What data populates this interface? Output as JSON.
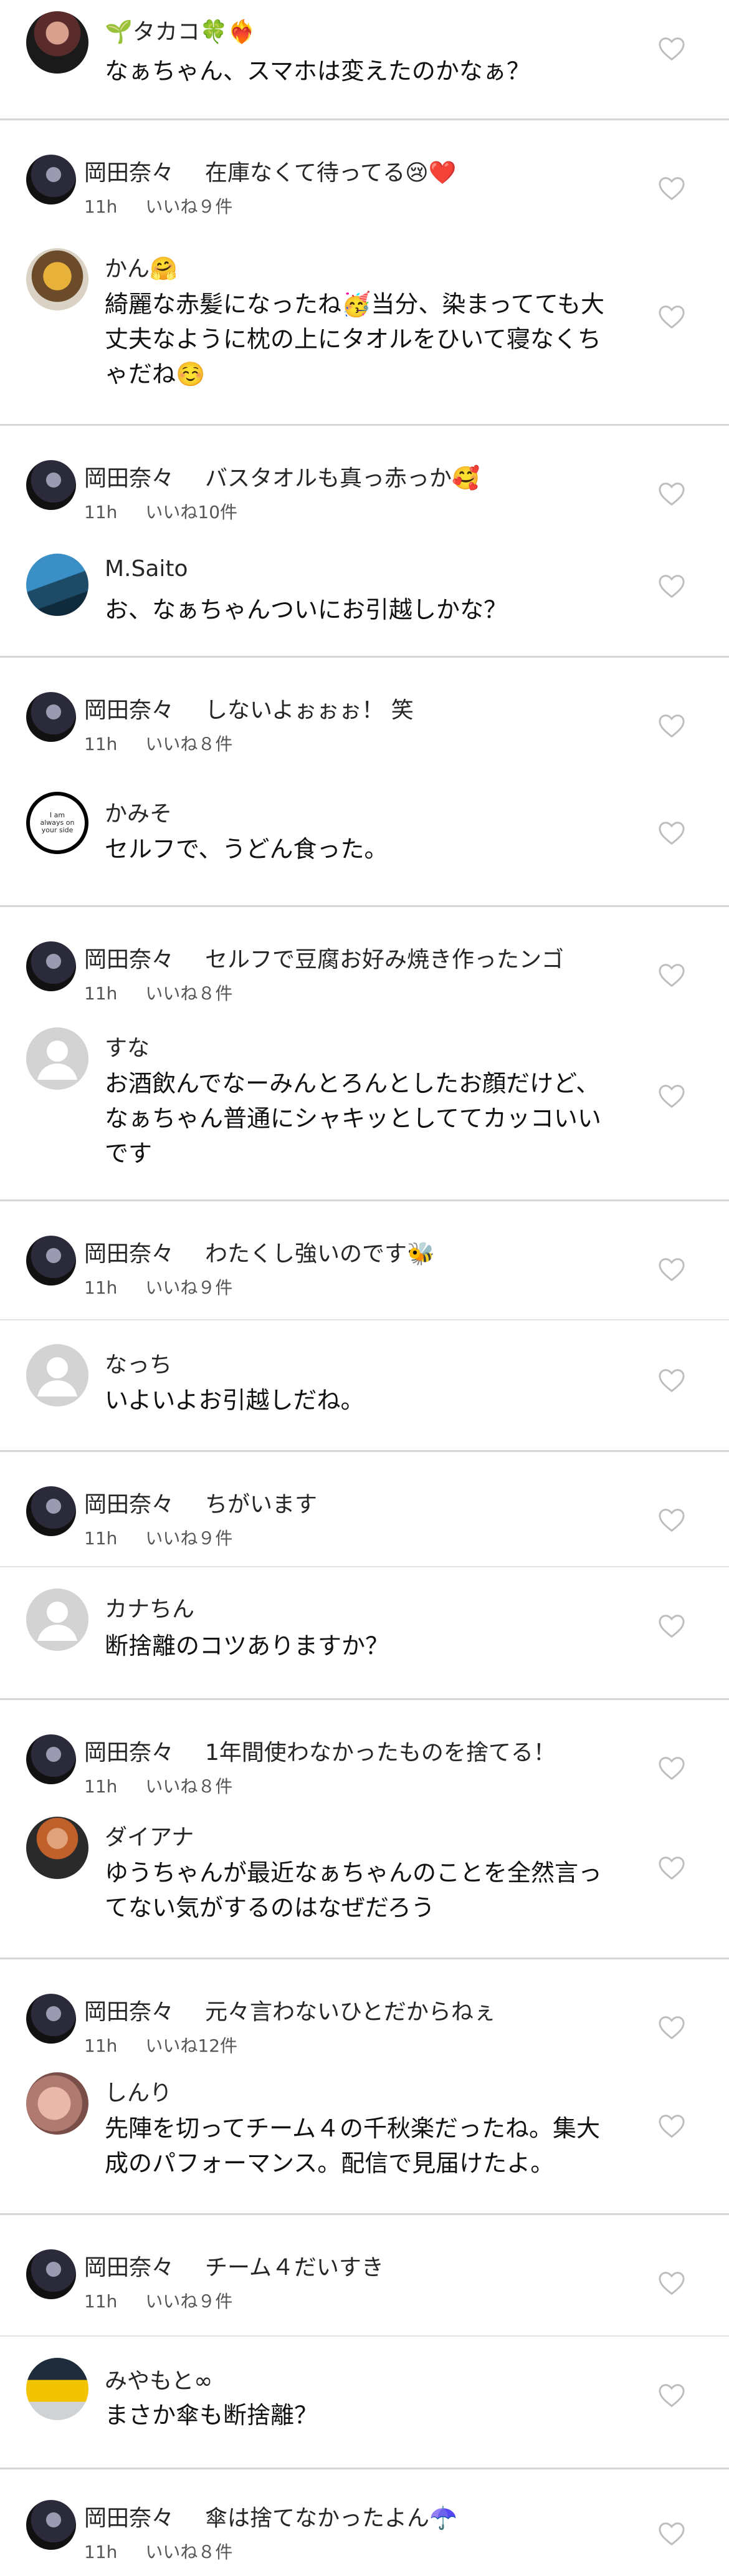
{
  "comments": [
    {
      "name": "🌱タカコ🍀❤️‍🔥",
      "text": [
        "なぁちゃん、スマホは変えたのかなぁ？"
      ]
    },
    {
      "name": "かん🤗",
      "text": [
        "綺麗な赤髪になったね🥳当分、染まってても大",
        "丈夫なように枕の上にタオルをひいて寝なくち",
        "ゃだね☺️"
      ]
    },
    {
      "name": "M.Saito",
      "text": [
        "お、なぁちゃんついにお引越しかな？"
      ]
    },
    {
      "name": "かみそ",
      "text": [
        "セルフで、うどん食った。"
      ],
      "avatar_text": "I am always on your side"
    },
    {
      "name": "すな",
      "text": [
        "お酒飲んでなーみんとろんとしたお顔だけど、",
        "なぁちゃん普通にシャキッとしててカッコいい",
        "です"
      ]
    },
    {
      "name": "なっち",
      "text": [
        "いよいよお引越しだね。"
      ]
    },
    {
      "name": "カナちん",
      "text": [
        "断捨離のコツありますか？"
      ]
    },
    {
      "name": "ダイアナ",
      "text": [
        "ゆうちゃんが最近なぁちゃんのことを全然言っ",
        "てない気がするのはなぜだろう"
      ]
    },
    {
      "name": "しんり",
      "text": [
        "先陣を切ってチーム４の千秋楽だったね。集大",
        "成のパフォーマンス。配信で見届けたよ。"
      ]
    },
    {
      "name": "みやもと∞",
      "text": [
        "まさか傘も断捨離？"
      ]
    }
  ],
  "replies": [
    {
      "name": "岡田奈々",
      "text": "在庫なくて待ってる😢❤️",
      "time": "11h",
      "likes": "いいね９件"
    },
    {
      "name": "岡田奈々",
      "text": "バスタオルも真っ赤っか🥰",
      "time": "11h",
      "likes": "いいね10件"
    },
    {
      "name": "岡田奈々",
      "text": "しないよぉぉぉ！ 笑",
      "time": "11h",
      "likes": "いいね８件"
    },
    {
      "name": "岡田奈々",
      "text": "セルフで豆腐お好み焼き作ったンゴ",
      "time": "11h",
      "likes": "いいね８件"
    },
    {
      "name": "岡田奈々",
      "text": "わたくし強いのです🐝",
      "time": "11h",
      "likes": "いいね９件"
    },
    {
      "name": "岡田奈々",
      "text": "ちがいます",
      "time": "11h",
      "likes": "いいね９件"
    },
    {
      "name": "岡田奈々",
      "text": "1年間使わなかったものを捨てる！",
      "time": "11h",
      "likes": "いいね８件"
    },
    {
      "name": "岡田奈々",
      "text": "元々言わないひとだからねぇ",
      "time": "11h",
      "likes": "いいね12件"
    },
    {
      "name": "岡田奈々",
      "text": "チーム４だいすき",
      "time": "11h",
      "likes": "いいね９件"
    },
    {
      "name": "岡田奈々",
      "text": "傘は捨てなかったよん☂️",
      "time": "11h",
      "likes": "いいね８件"
    }
  ],
  "colors": {
    "text": "#262626",
    "meta": "#555555",
    "heart": "#bdbdbd",
    "separator": "#d6d6d6"
  }
}
